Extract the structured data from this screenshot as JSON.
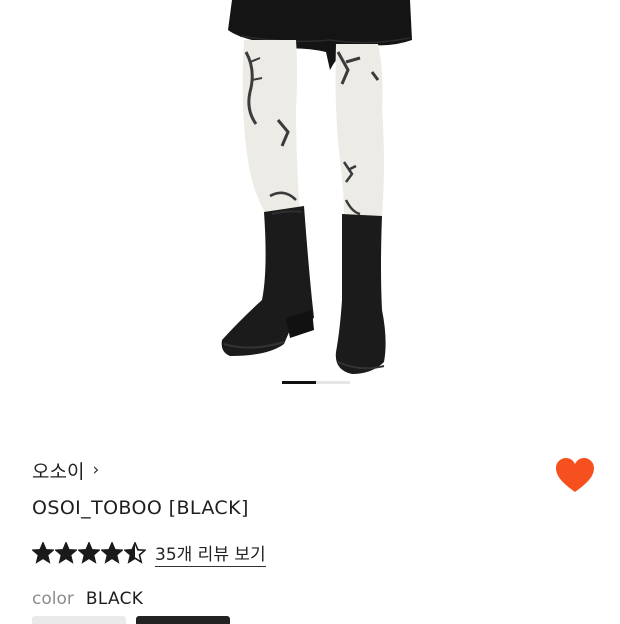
{
  "brand": {
    "name": "오소이",
    "chevron": "›"
  },
  "product": {
    "name": "OSOI_TOBOO [BLACK]"
  },
  "rating": {
    "value": 4.5,
    "max": 5,
    "review_link": "35개 리뷰 보기"
  },
  "option": {
    "label": "color",
    "value": "BLACK"
  },
  "carousel": {
    "current": 1
  },
  "colors": {
    "heart": "#f5501e",
    "star": "#1a1a1a"
  },
  "icons": {
    "wishlist": "heart-icon",
    "brand_arrow": "chevron-right-icon",
    "rating": "star-icon"
  }
}
